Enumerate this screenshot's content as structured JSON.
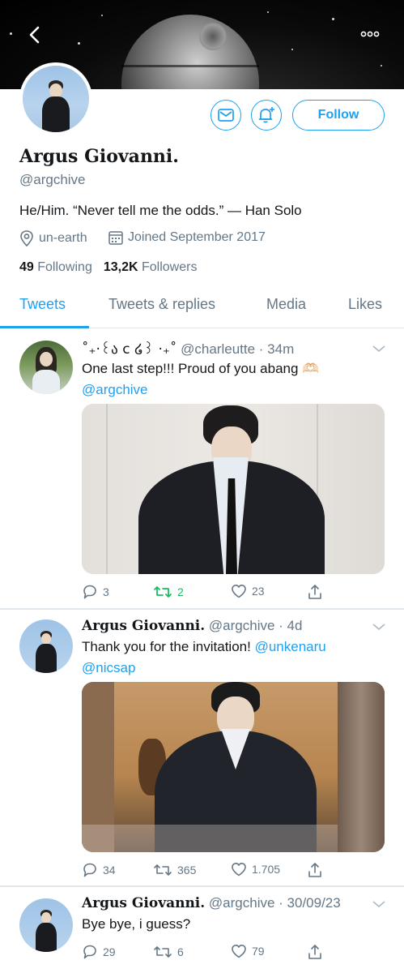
{
  "profile": {
    "name": "Argus Giovanni.",
    "handle": "@argchive",
    "bio": "He/Him. “Never tell me the odds.” — Han Solo",
    "location": "un-earth",
    "joined": "Joined September 2017",
    "following_count": "49",
    "following_label": "Following",
    "followers_count": "13,2K",
    "followers_label": "Followers"
  },
  "buttons": {
    "follow": "Follow"
  },
  "tabs": [
    {
      "label": "Tweets",
      "active": true
    },
    {
      "label": "Tweets & replies",
      "active": false
    },
    {
      "label": "Media",
      "active": false
    },
    {
      "label": "Likes",
      "active": false
    }
  ],
  "tweets": [
    {
      "author": "˚₊‧꒰ა c ໒꒱ ‧₊˚",
      "handle": "@charleutte",
      "time": "34m",
      "text": "One last step!!! Proud of you abang 🫶🏻",
      "mentions": [
        "@argchive"
      ],
      "replies": "3",
      "retweets": "2",
      "likes": "23",
      "retweeted": true
    },
    {
      "author": "Argus Giovanni.",
      "handle": "@argchive",
      "time": "4d",
      "text": "Thank you for the invitation!",
      "mentions": [
        "@unkenaru",
        "@nicsap"
      ],
      "replies": "34",
      "retweets": "365",
      "likes": "1.705",
      "retweeted": false
    },
    {
      "author": "Argus Giovanni.",
      "handle": "@argchive",
      "time": "30/09/23",
      "text": "Bye bye, i guess?",
      "mentions": [],
      "replies": "29",
      "retweets": "6",
      "likes": "79",
      "retweeted": false
    }
  ],
  "colors": {
    "accent": "#1da1f2",
    "retweet_active": "#17bf63",
    "secondary_text": "#657786"
  },
  "icons": [
    "back-arrow-icon",
    "more-icon",
    "mail-icon",
    "bell-plus-icon",
    "location-icon",
    "calendar-icon",
    "reply-icon",
    "retweet-icon",
    "like-icon",
    "share-icon",
    "chevron-down-icon"
  ]
}
